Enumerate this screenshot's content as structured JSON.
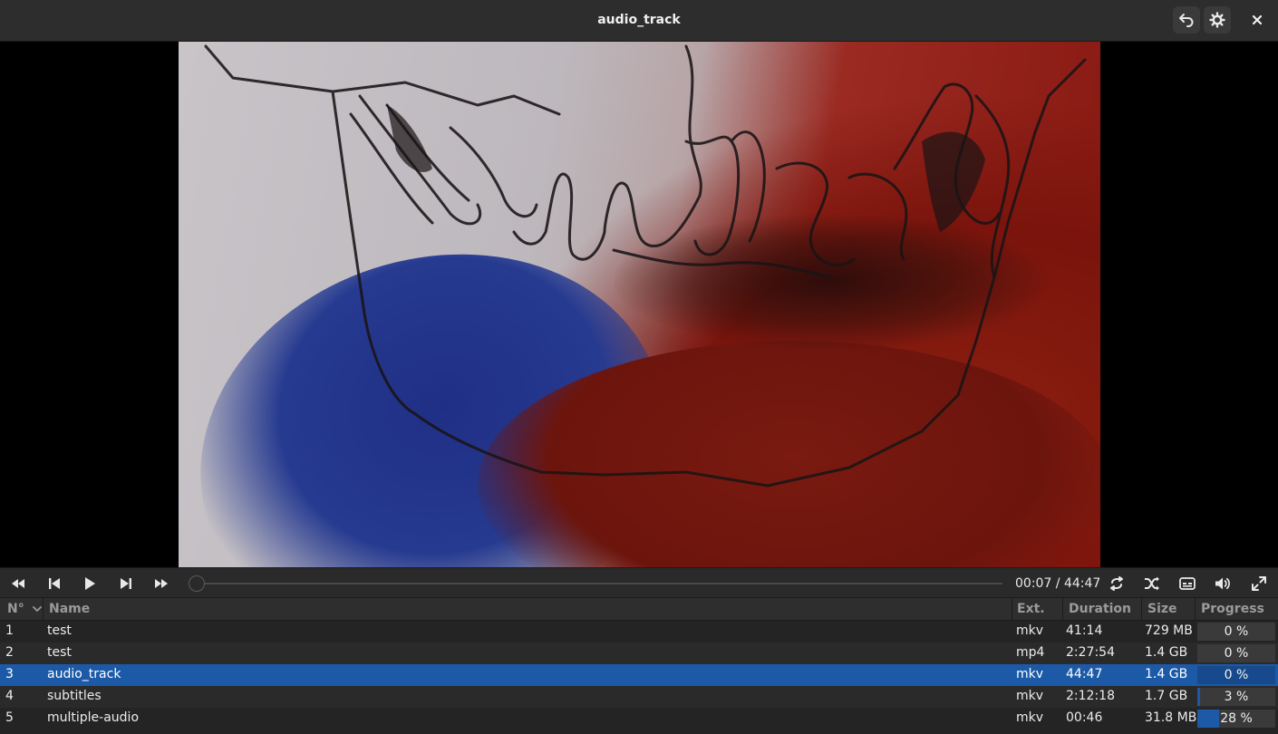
{
  "window": {
    "title": "audio_track"
  },
  "header": {
    "back_icon": "back-arrow-icon",
    "preferences_icon": "gear-icon",
    "close_icon": "close-icon"
  },
  "player": {
    "controls": {
      "rewind_icon": "rewind-icon",
      "previous_icon": "skip-previous-icon",
      "play_icon": "play-icon",
      "next_icon": "skip-next-icon",
      "forward_icon": "fast-forward-icon",
      "repeat_icon": "repeat-icon",
      "shuffle_icon": "shuffle-icon",
      "subtitles_icon": "subtitles-icon",
      "volume_icon": "volume-icon",
      "fullscreen_icon": "fullscreen-icon"
    },
    "time_display": "00:07 / 44:47",
    "seek_position": 0.003
  },
  "playlist": {
    "columns": {
      "number": "N°",
      "name": "Name",
      "ext": "Ext.",
      "duration": "Duration",
      "size": "Size",
      "progress": "Progress"
    },
    "rows": [
      {
        "number": "1",
        "name": "test",
        "ext": "mkv",
        "duration": "41:14",
        "size": "729 MB",
        "progress": "0 %",
        "progress_value": 0,
        "selected": false
      },
      {
        "number": "2",
        "name": "test",
        "ext": "mp4",
        "duration": "2:27:54",
        "size": "1.4 GB",
        "progress": "0 %",
        "progress_value": 0,
        "selected": false
      },
      {
        "number": "3",
        "name": "audio_track",
        "ext": "mkv",
        "duration": "44:47",
        "size": "1.4 GB",
        "progress": "0 %",
        "progress_value": 0,
        "selected": true
      },
      {
        "number": "4",
        "name": "subtitles",
        "ext": "mkv",
        "duration": "2:12:18",
        "size": "1.7 GB",
        "progress": "3 %",
        "progress_value": 3,
        "selected": false
      },
      {
        "number": "5",
        "name": "multiple-audio",
        "ext": "mkv",
        "duration": "00:46",
        "size": "31.8 MB",
        "progress": "28 %",
        "progress_value": 28,
        "selected": false
      }
    ]
  },
  "colors": {
    "accent": "#1c5aa8",
    "background": "#242424",
    "header": "#2d2d2d"
  }
}
